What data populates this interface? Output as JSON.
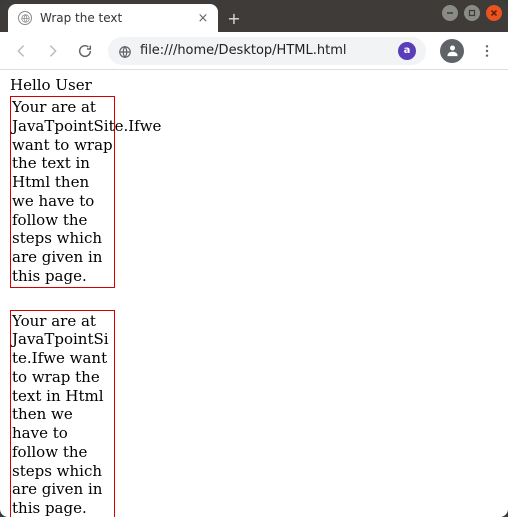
{
  "window": {
    "title": "Wrap the text"
  },
  "toolbar": {
    "url": "file:///home/Desktop/HTML.html",
    "ext_label": "a"
  },
  "page": {
    "greeting": "Hello User",
    "box1_text": "Your are at JavaTpointSite.Ifwe want to wrap the text in Html then we have to follow the steps which are given in this page.",
    "box2_text": "Your are at JavaTpointSite.Ifwe want to wrap the text in Html then we have to follow the steps which are given in this page."
  }
}
